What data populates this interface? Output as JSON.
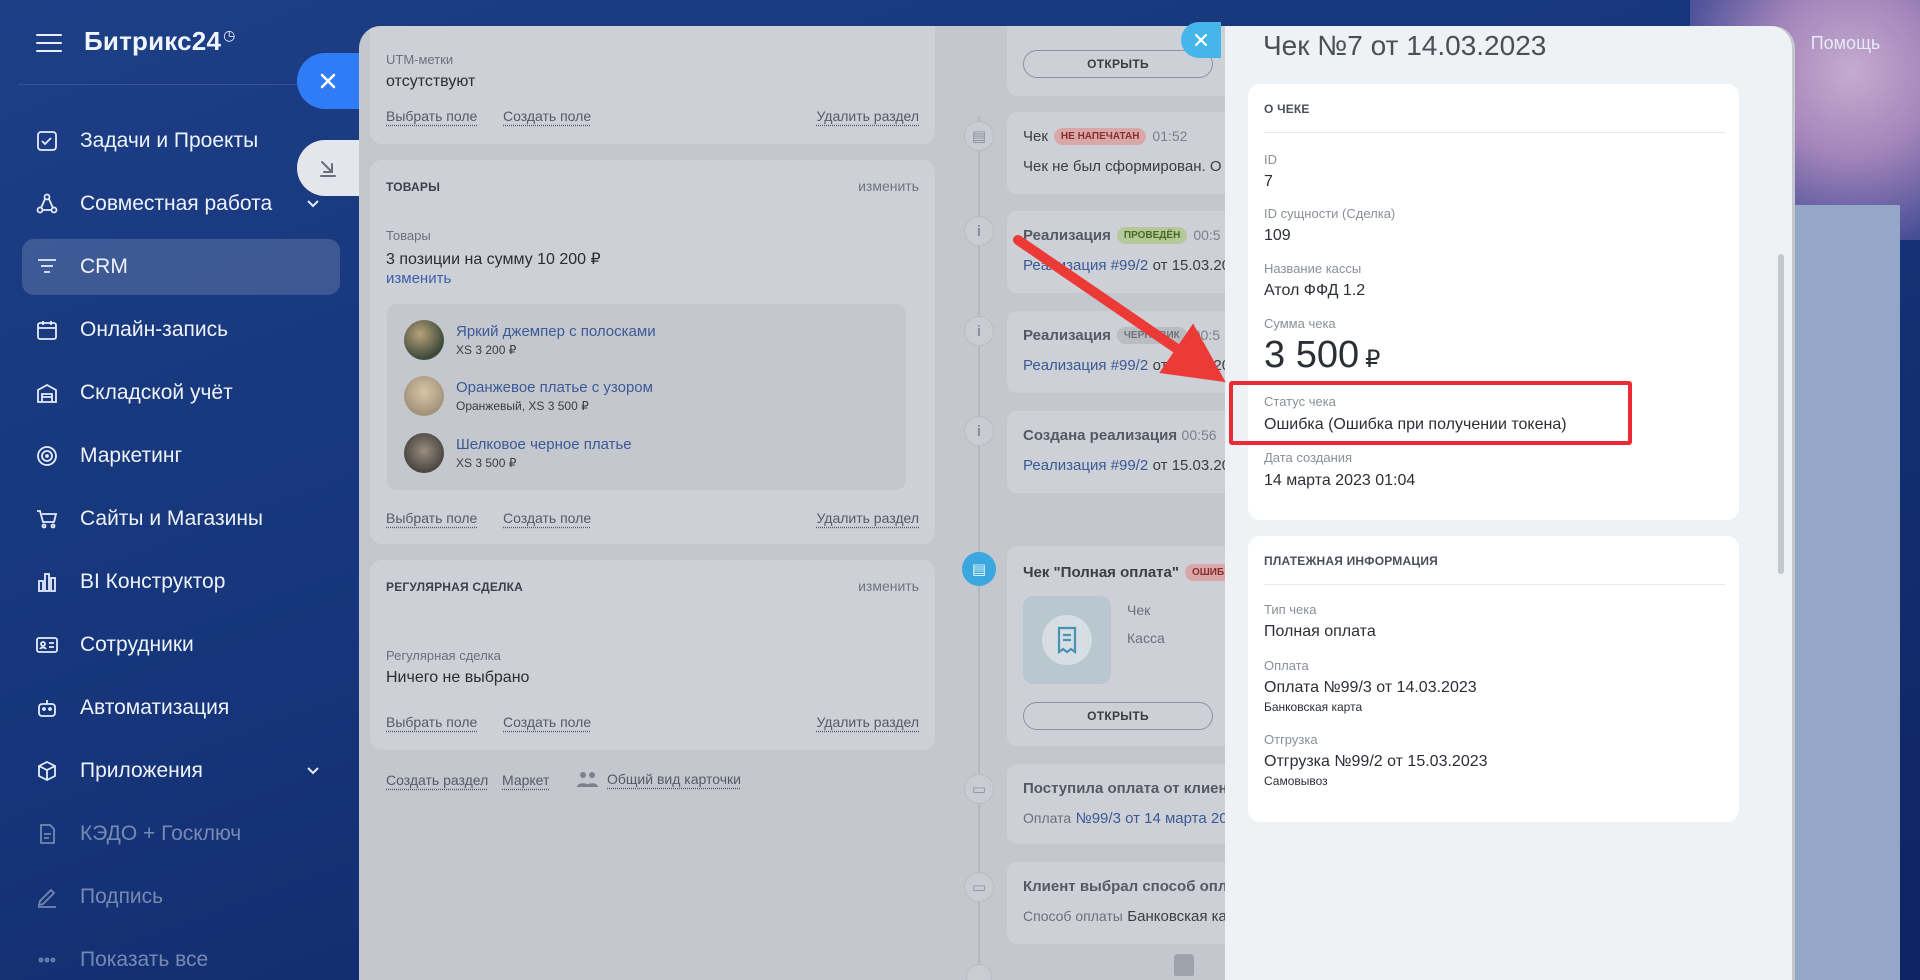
{
  "brand": {
    "name": "Битрикс24",
    "clock_glyph": "◷"
  },
  "help_label": "Помощь",
  "sidebar": {
    "items": [
      {
        "label": "Задачи и Проекты",
        "icon": "checkbox-icon"
      },
      {
        "label": "Совместная работа",
        "icon": "collab-icon"
      },
      {
        "label": "CRM",
        "icon": "crm-funnel-icon"
      },
      {
        "label": "Онлайн-запись",
        "icon": "calendar-icon"
      },
      {
        "label": "Складской учёт",
        "icon": "warehouse-icon"
      },
      {
        "label": "Маркетинг",
        "icon": "target-icon"
      },
      {
        "label": "Сайты и Магазины",
        "icon": "cart-icon"
      },
      {
        "label": "BI Конструктор",
        "icon": "bar-chart-icon"
      },
      {
        "label": "Сотрудники",
        "icon": "id-card-icon"
      },
      {
        "label": "Автоматизация",
        "icon": "robot-icon"
      },
      {
        "label": "Приложения",
        "icon": "cube-icon"
      },
      {
        "label": "КЭДО + Госключ",
        "icon": "document-icon"
      },
      {
        "label": "Подпись",
        "icon": "pen-icon"
      },
      {
        "label": "Показать все",
        "icon": "more-icon"
      }
    ]
  },
  "main": {
    "utm": {
      "label": "UTM-метки",
      "value": "отсутствуют",
      "select_field": "Выбрать поле",
      "create_field": "Создать поле",
      "delete_section": "Удалить раздел"
    },
    "goods": {
      "header": "ТОВАРЫ",
      "edit": "изменить",
      "label": "Товары",
      "summary": "3 позиции на сумму 10 200 ₽",
      "change": "изменить",
      "products": [
        {
          "name": "Яркий джемпер с полосками",
          "meta": "XS   3 200 ₽"
        },
        {
          "name": "Оранжевое платье с узором",
          "meta": "Оранжевый, XS   3 500 ₽"
        },
        {
          "name": "Шелковое черное платье",
          "meta": "XS   3 500 ₽"
        }
      ],
      "select_field": "Выбрать поле",
      "create_field": "Создать поле",
      "delete_section": "Удалить раздел"
    },
    "regular": {
      "header": "РЕГУЛЯРНАЯ СДЕЛКА",
      "edit": "изменить",
      "label": "Регулярная сделка",
      "value": "Ничего не выбрано",
      "select_field": "Выбрать поле",
      "create_field": "Создать поле",
      "delete_section": "Удалить раздел"
    },
    "footer": {
      "create_section": "Создать раздел",
      "market": "Маркет",
      "general_view": "Общий вид карточки"
    }
  },
  "timeline": {
    "open": "ОТКРЫТЬ",
    "check1": {
      "title": "Чек",
      "badge": "НЕ НАПЕЧАТАН",
      "time": "01:52",
      "text": "Чек не был сформирован. О"
    },
    "real1": {
      "title": "Реализация",
      "badge": "ПРОВЕДЁН",
      "time": "00:5",
      "link": "Реализация #99/2",
      "rest": "от 15.03.20"
    },
    "real2": {
      "title": "Реализация",
      "badge": "ЧЕРНОВИК",
      "time": "00:5",
      "link": "Реализация #99/2",
      "rest": "от 15.03.20"
    },
    "real3": {
      "title": "Создана реализация",
      "time": "00:56",
      "link": "Реализация #99/2",
      "rest": "от 15.03.20"
    },
    "check2": {
      "title": "Чек \"Полная оплата\"",
      "badge": "ОШИБ",
      "line1": "Чек",
      "line2": "Касса"
    },
    "payment": {
      "title": "Поступила оплата от клиент",
      "prefix": "Оплата",
      "link": "№99/3 от 14 марта 20"
    },
    "method": {
      "title": "Клиент выбрал способ опла",
      "prefix": "Способ оплаты",
      "rest": "Банковская ка"
    }
  },
  "slider": {
    "title": "Чек №7 от 14.03.2023",
    "about": {
      "header": "О ЧЕКЕ",
      "id_label": "ID",
      "id_value": "7",
      "entity_label": "ID сущности (Сделка)",
      "entity_value": "109",
      "cashbox_label": "Название кассы",
      "cashbox_value": "Атол ФФД 1.2",
      "sum_label": "Сумма чека",
      "sum_value": "3 500",
      "sum_currency": "₽",
      "status_label": "Статус чека",
      "status_value": "Ошибка (Ошибка при получении токена)",
      "date_label": "Дата создания",
      "date_value": "14 марта 2023 01:04"
    },
    "payment": {
      "header": "ПЛАТЕЖНАЯ ИНФОРМАЦИЯ",
      "type_label": "Тип чека",
      "type_value": "Полная оплата",
      "pay_label": "Оплата",
      "pay_value": "Оплата №99/3 от 14.03.2023",
      "pay_note": "Банковская карта",
      "ship_label": "Отгрузка",
      "ship_value": "Отгрузка №99/2 от 15.03.2023",
      "ship_note": "Самовывоз"
    }
  },
  "colors": {
    "accent_blue": "#2f7cf6",
    "highlight_red": "#ec2a35",
    "timeline_blue": "#46b6ea"
  }
}
